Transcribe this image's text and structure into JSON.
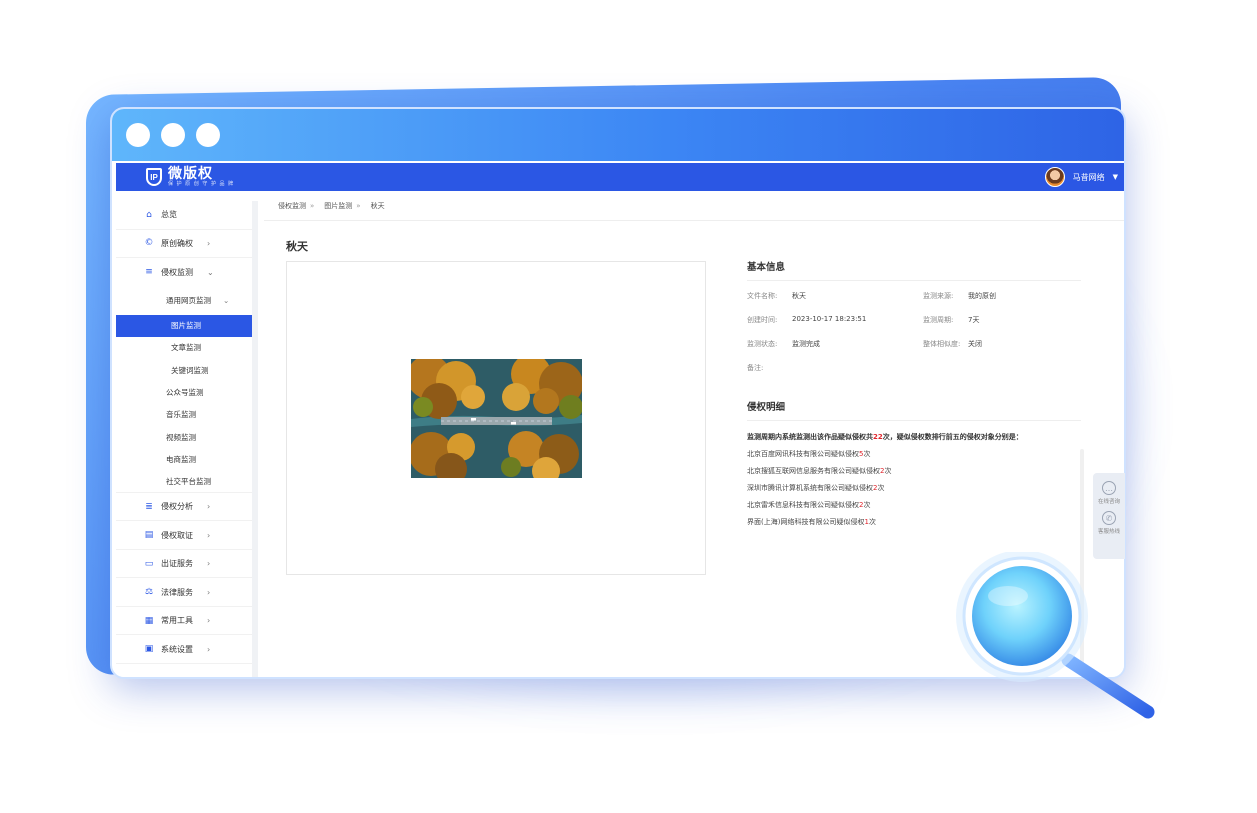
{
  "app": {
    "logo_name": "微版权",
    "logo_slogan": "保 护 原 创 守 护 品 牌",
    "logo_mark": "IP",
    "user_name": "马昔网络"
  },
  "sidebar": {
    "items": [
      {
        "label": "总览",
        "icon": "home-icon",
        "has_children": false
      },
      {
        "label": "原创确权",
        "icon": "copyright-icon",
        "has_children": true
      },
      {
        "label": "侵权监测",
        "icon": "monitor-icon",
        "has_children": true,
        "expanded": true
      }
    ],
    "submenu_group": "通用网页监测",
    "submenu_group_items": [
      "图片监测",
      "文章监测",
      "关键词监测"
    ],
    "active_item": "图片监测",
    "submenu_items": [
      "公众号监测",
      "音乐监测",
      "视频监测",
      "电商监测",
      "社交平台监测"
    ],
    "bottom_items": [
      {
        "label": "侵权分析",
        "icon": "analysis-icon"
      },
      {
        "label": "侵权取证",
        "icon": "evidence-icon"
      },
      {
        "label": "出证服务",
        "icon": "certificate-icon"
      },
      {
        "label": "法律服务",
        "icon": "legal-icon"
      },
      {
        "label": "常用工具",
        "icon": "tools-icon"
      },
      {
        "label": "系统设置",
        "icon": "settings-icon"
      }
    ]
  },
  "breadcrumb": [
    "侵权监测",
    "图片监测",
    "秋天"
  ],
  "breadcrumb_sep": "»",
  "page_title": "秋天",
  "basic_info": {
    "title": "基本信息",
    "fields": [
      {
        "label": "文件名称:",
        "value": "秋天"
      },
      {
        "label": "监测来源:",
        "value": "我的原创"
      },
      {
        "label": "创建时间:",
        "value": "2023-10-17 18:23:51"
      },
      {
        "label": "监测周期:",
        "value": "7天"
      },
      {
        "label": "监测状态:",
        "value": "监测完成"
      },
      {
        "label": "整体相似度:",
        "value": "关闭"
      },
      {
        "label": "备注:",
        "value": ""
      }
    ]
  },
  "infringement": {
    "title": "侵权明细",
    "summary_prefix": "监测周期内系统监测出该作品疑似侵权共",
    "summary_count": "22",
    "summary_suffix": "次，疑似侵权数排行前五的侵权对象分别是：",
    "rows": [
      {
        "company": "北京百度网讯科技有限公司疑似侵权",
        "count": "5",
        "unit": "次"
      },
      {
        "company": "北京搜狐互联网信息服务有限公司疑似侵权",
        "count": "2",
        "unit": "次"
      },
      {
        "company": "深圳市腾讯计算机系统有限公司疑似侵权",
        "count": "2",
        "unit": "次"
      },
      {
        "company": "北京雷禾信息科技有限公司疑似侵权",
        "count": "2",
        "unit": "次"
      },
      {
        "company": "界面(上海)网络科技有限公司疑似侵权",
        "count": "1",
        "unit": "次"
      }
    ]
  },
  "float_tools": [
    {
      "label": "在线咨询",
      "icon": "chat-icon"
    },
    {
      "label": "客服热线",
      "icon": "phone-icon"
    }
  ],
  "colors": {
    "primary": "#2b57e4",
    "accent_red": "#e0242b",
    "titlebar_start": "#5fb6fb",
    "titlebar_end": "#2e64e6"
  }
}
